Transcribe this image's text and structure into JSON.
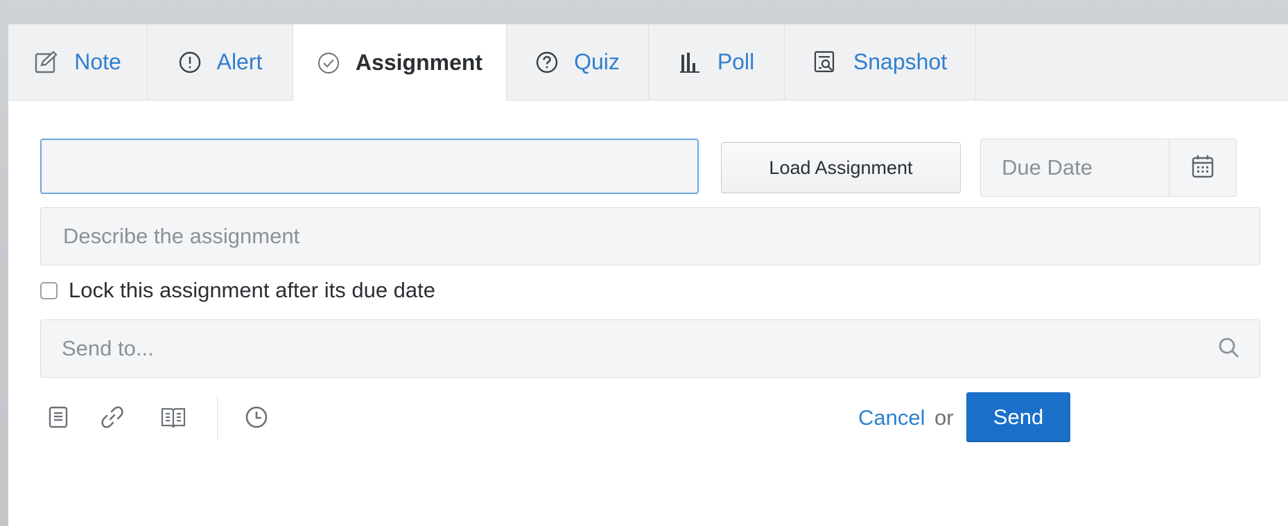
{
  "tabs": [
    {
      "label": "Note",
      "icon": "edit-note-icon"
    },
    {
      "label": "Alert",
      "icon": "alert-circle-icon"
    },
    {
      "label": "Assignment",
      "icon": "check-circle-icon",
      "active": true
    },
    {
      "label": "Quiz",
      "icon": "question-circle-icon"
    },
    {
      "label": "Poll",
      "icon": "bar-chart-icon"
    },
    {
      "label": "Snapshot",
      "icon": "snapshot-icon"
    }
  ],
  "form": {
    "title_value": "",
    "load_button": "Load Assignment",
    "due_date_placeholder": "Due Date",
    "description_placeholder": "Describe the assignment",
    "lock_label": "Lock this assignment after its due date",
    "lock_checked": false,
    "send_to_placeholder": "Send to..."
  },
  "footer": {
    "tools": [
      "document-icon",
      "link-icon",
      "library-icon",
      "clock-icon"
    ],
    "cancel_label": "Cancel",
    "or_label": "or",
    "send_label": "Send"
  },
  "colors": {
    "accent": "#2f7fd0",
    "send_button": "#1a6fc9",
    "focus_border": "#6aa6e0"
  }
}
